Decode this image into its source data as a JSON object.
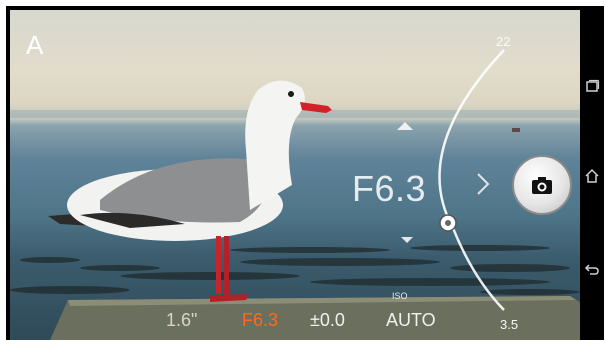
{
  "camera": {
    "mode": "A",
    "aperture_display": "F6.3",
    "arc_max_label": "22",
    "arc_min_label": "3.5",
    "aperture_level": 0.72
  },
  "status_bar": {
    "shutter_speed": "1.6\"",
    "aperture": "F6.3",
    "exposure_comp": "±0.0",
    "iso_label": "ISO",
    "iso": "AUTO"
  },
  "colors": {
    "active_setting": "#ff6a1a",
    "text": "#ffffff",
    "navbar": "#000000"
  },
  "icons": {
    "shutter": "camera-icon",
    "nav_recents": "recent-apps-icon",
    "nav_home": "home-icon",
    "nav_back": "back-icon"
  }
}
